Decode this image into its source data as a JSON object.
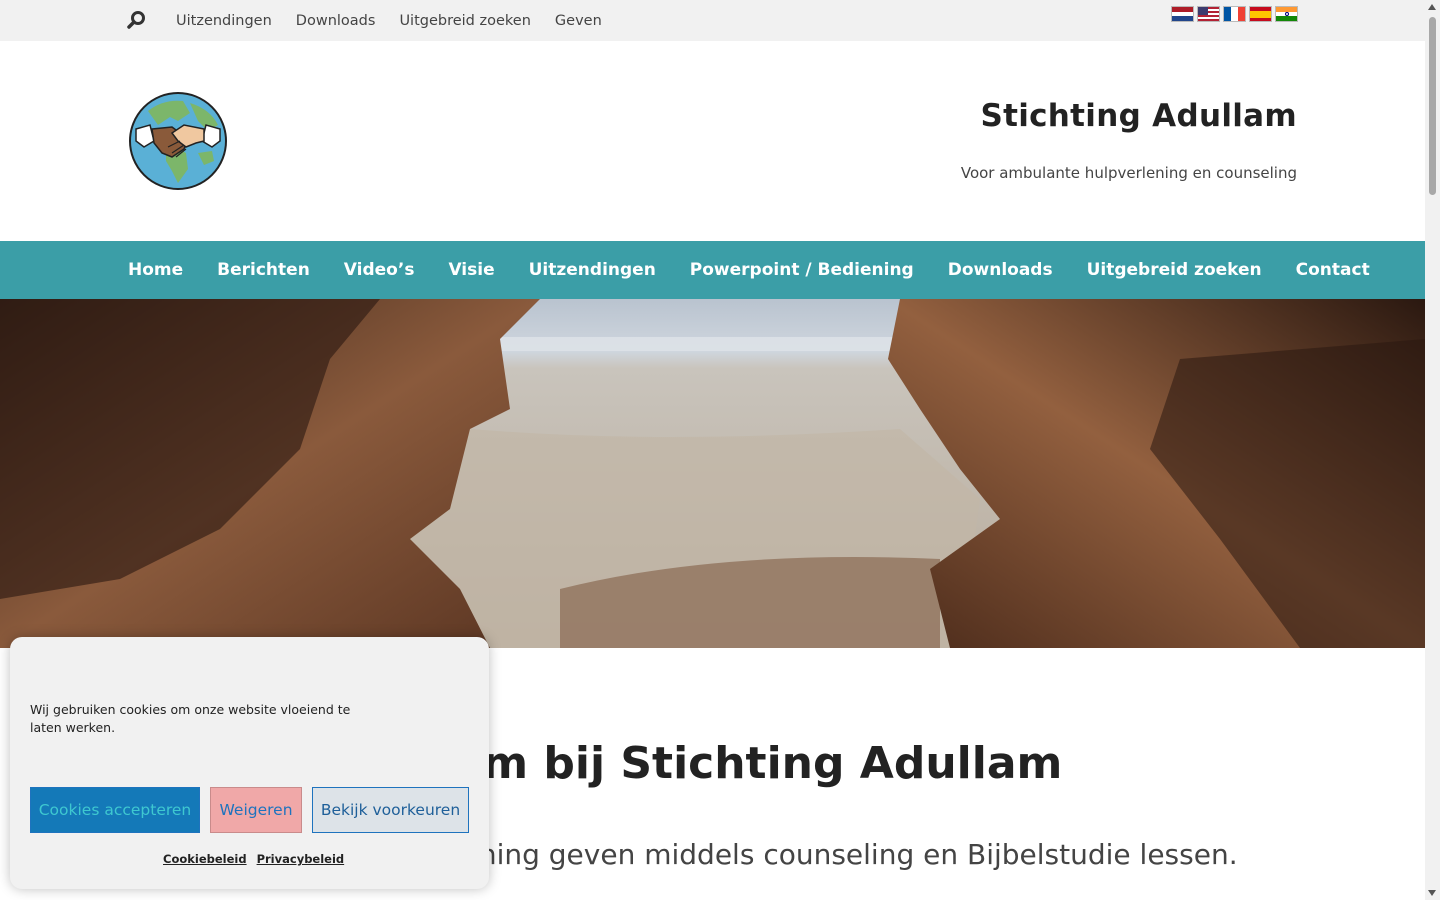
{
  "topbar": {
    "nav": [
      "Uitzendingen",
      "Downloads",
      "Uitgebreid zoeken",
      "Geven"
    ],
    "languages": [
      "dutch-flag-icon",
      "us-flag-icon",
      "french-flag-icon",
      "spanish-flag-icon",
      "indian-flag-icon"
    ]
  },
  "header": {
    "title": "Stichting Adullam",
    "tagline": "Voor ambulante hulpverlening en counseling"
  },
  "mainnav": {
    "items": [
      "Home",
      "Berichten",
      "Video’s",
      "Visie",
      "Uitzendingen",
      "Powerpoint / Bediening",
      "Downloads",
      "Uitgebreid zoeken",
      "Contact"
    ]
  },
  "content": {
    "welcome": "Welkom bij Stichting Adullam",
    "subtext": "Ondersteuning geven middels counseling en Bijbelstudie lessen."
  },
  "cookie": {
    "message": "Wij gebruiken cookies om onze website vloeiend te laten werken.",
    "accept": "Cookies accepteren",
    "deny": "Weigeren",
    "preferences": "Bekijk voorkeuren",
    "links": [
      "Cookiebeleid",
      "Privacybeleid"
    ]
  },
  "colors": {
    "nav_bg": "#3b9ea7",
    "topbar_bg": "#f1f1f1"
  }
}
